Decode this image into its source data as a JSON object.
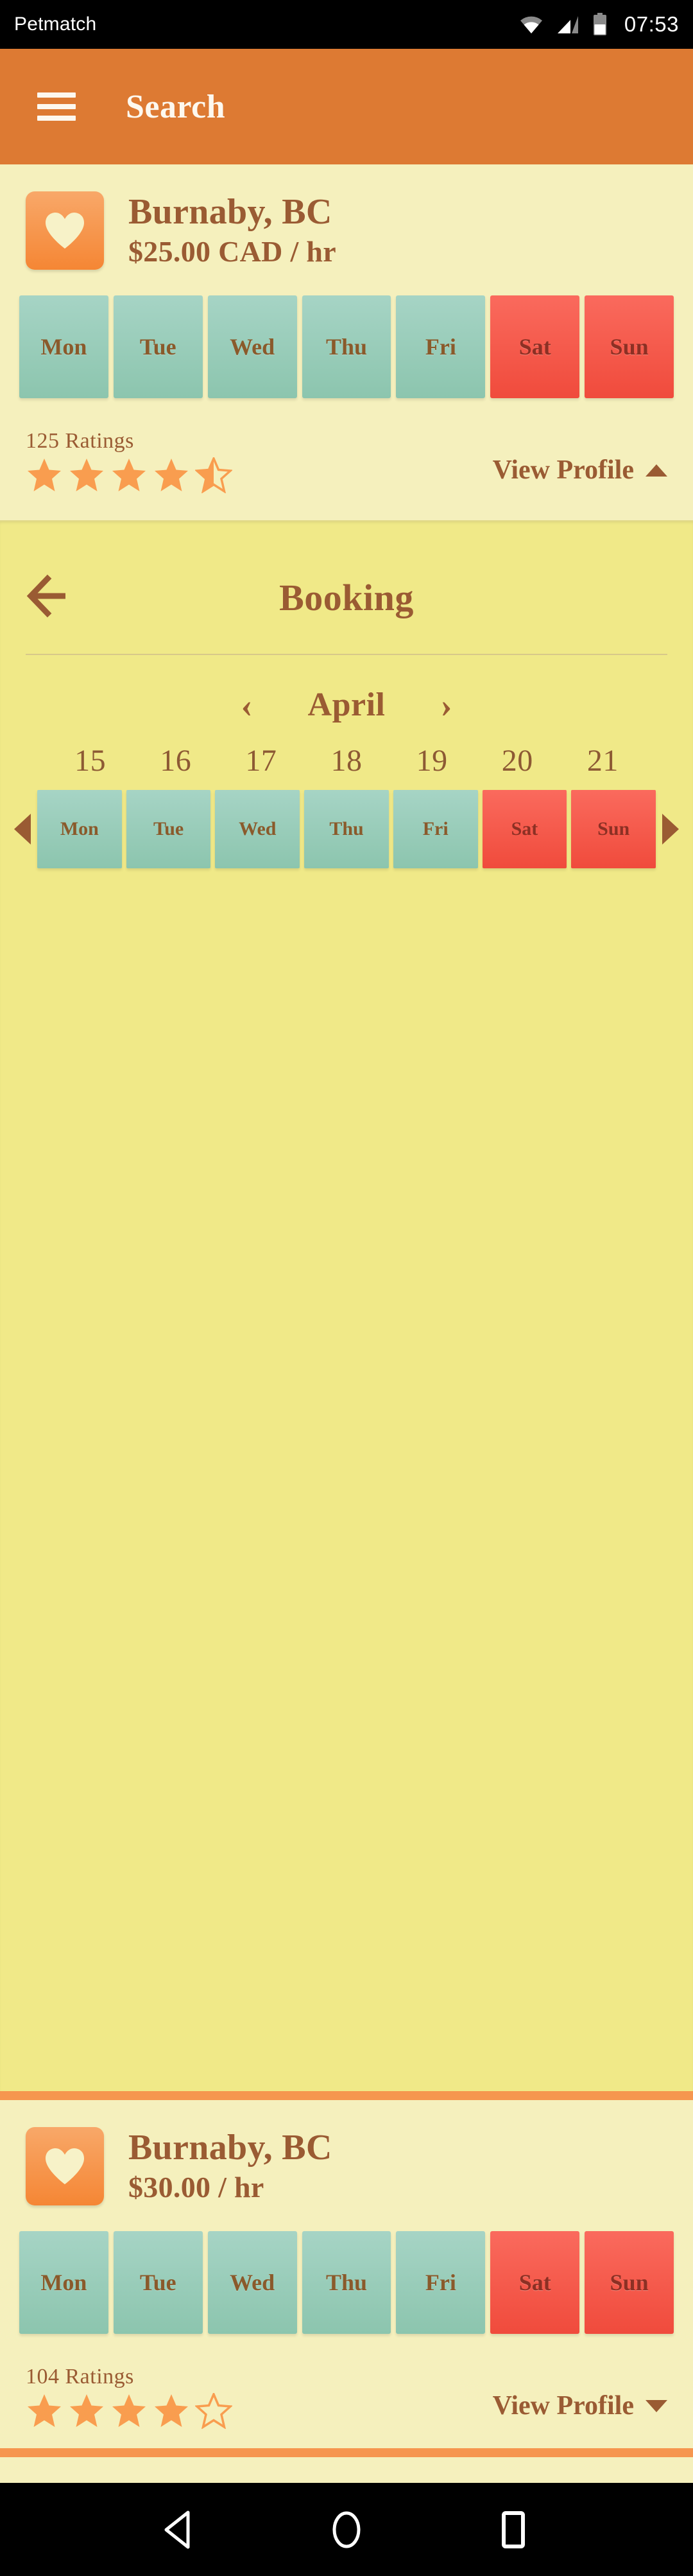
{
  "status_bar": {
    "app_name": "Petmatch",
    "time": "07:53",
    "icons": [
      "wifi-icon",
      "cellular-signal-icon",
      "battery-icon"
    ]
  },
  "app_bar": {
    "menu_icon": "hamburger-menu-icon",
    "title": "Search"
  },
  "colors": {
    "accent_orange": "#dd7a33",
    "divider_orange": "#f6964f",
    "card_bg": "#f5f0bd",
    "booking_bg": "#f0e988",
    "brown_text": "#9a5b33",
    "weekday_chip": "#8cc5ae",
    "weekend_chip": "#f04b3c",
    "star_orange": "#f99d4f"
  },
  "listings": [
    {
      "favorite_icon": "heart-icon",
      "location": "Burnaby, BC",
      "price": "$25.00 CAD / hr",
      "days": [
        {
          "label": "Mon",
          "type": "weekday"
        },
        {
          "label": "Tue",
          "type": "weekday"
        },
        {
          "label": "Wed",
          "type": "weekday"
        },
        {
          "label": "Thu",
          "type": "weekday"
        },
        {
          "label": "Fri",
          "type": "weekday"
        },
        {
          "label": "Sat",
          "type": "weekend"
        },
        {
          "label": "Sun",
          "type": "weekend"
        }
      ],
      "ratings_count": "125 Ratings",
      "rating_value": 4.5,
      "stars": [
        "full",
        "full",
        "full",
        "full",
        "half"
      ],
      "view_profile_label": "View Profile",
      "expanded": true,
      "caret": "chevron-up"
    },
    {
      "favorite_icon": "heart-icon",
      "location": "Burnaby, BC",
      "price": "$30.00 / hr",
      "days": [
        {
          "label": "Mon",
          "type": "weekday"
        },
        {
          "label": "Tue",
          "type": "weekday"
        },
        {
          "label": "Wed",
          "type": "weekday"
        },
        {
          "label": "Thu",
          "type": "weekday"
        },
        {
          "label": "Fri",
          "type": "weekday"
        },
        {
          "label": "Sat",
          "type": "weekend"
        },
        {
          "label": "Sun",
          "type": "weekend"
        }
      ],
      "ratings_count": "104 Ratings",
      "rating_value": 4,
      "stars": [
        "full",
        "full",
        "full",
        "full",
        "empty"
      ],
      "view_profile_label": "View Profile",
      "expanded": false,
      "caret": "chevron-down"
    }
  ],
  "booking": {
    "back_icon": "back-arrow-icon",
    "title": "Booking",
    "month": "April",
    "prev_month_icon": "chevron-left-icon",
    "next_month_icon": "chevron-right-icon",
    "prev_week_icon": "triangle-left-icon",
    "next_week_icon": "triangle-right-icon",
    "dates": [
      "15",
      "16",
      "17",
      "18",
      "19",
      "20",
      "21"
    ],
    "days": [
      {
        "label": "Mon",
        "type": "weekday"
      },
      {
        "label": "Tue",
        "type": "weekday"
      },
      {
        "label": "Wed",
        "type": "weekday"
      },
      {
        "label": "Thu",
        "type": "weekday"
      },
      {
        "label": "Fri",
        "type": "weekday"
      },
      {
        "label": "Sat",
        "type": "weekend"
      },
      {
        "label": "Sun",
        "type": "weekend"
      }
    ]
  },
  "nav_bar": {
    "back_label": "back-triangle-icon",
    "home_label": "home-circle-icon",
    "recents_label": "recents-square-icon"
  }
}
